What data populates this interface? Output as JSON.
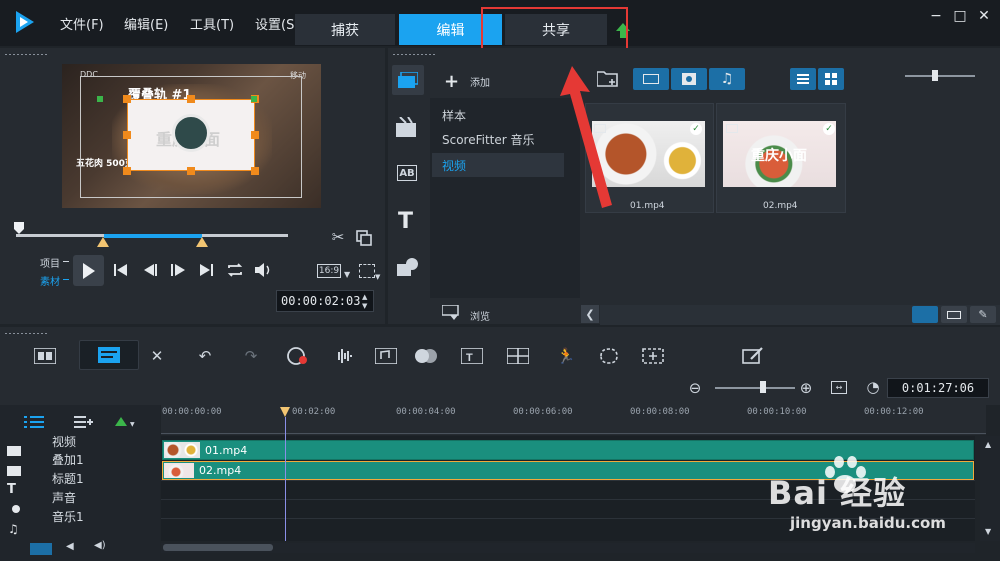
{
  "menu": {
    "file": "文件(F)",
    "edit": "编辑(E)",
    "tools": "工具(T)",
    "settings": "设置(S"
  },
  "tabs": {
    "capture": "捕获",
    "edit": "编辑",
    "share": "共享"
  },
  "window": {
    "minimize": "−",
    "maximize": "□",
    "close": "✕"
  },
  "preview": {
    "watermark_left": "DDC",
    "watermark_right": "移动",
    "overlay_title": "覆叠轨 #1",
    "subtitle": "五花肉 500克",
    "sticker_text": "重庆小面",
    "mode_project": "项目",
    "mode_clip": "素材",
    "aspect": "16:9",
    "timecode": "00:00:02:03"
  },
  "library": {
    "add_label": "添加",
    "categories": [
      "样本",
      "ScoreFitter 音乐",
      "视频"
    ],
    "selected_category": "视频",
    "browse_label": "浏览",
    "clips": [
      {
        "name": "01.mp4"
      },
      {
        "name": "02.mp4"
      }
    ],
    "thumb2_text": "重庆小面"
  },
  "timeline": {
    "duration": "0:01:27:06",
    "ticks": [
      "00:00:00:00",
      "00:02:00",
      "00:00:04:00",
      "00:00:06:00",
      "00:00:08:00",
      "00:00:10:00",
      "00:00:12:00"
    ],
    "tracks": [
      "视频",
      "叠加1",
      "标题1",
      "声音",
      "音乐1"
    ],
    "clips": {
      "video": "01.mp4",
      "overlay": "02.mp4"
    }
  },
  "annotation": {
    "color": "#e53935"
  },
  "colors": {
    "accent": "#1ba3f0",
    "clip": "#1a8f7e",
    "arrow": "#e53935"
  },
  "watermark": {
    "brand": "Bai 经验",
    "url": "jingyan.baidu.com"
  }
}
